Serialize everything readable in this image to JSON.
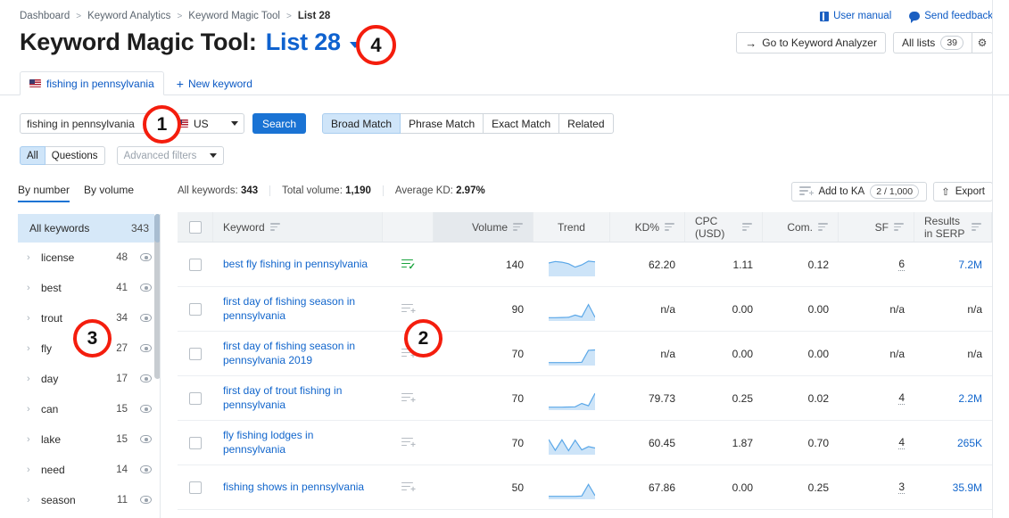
{
  "breadcrumb": [
    "Dashboard",
    "Keyword Analytics",
    "Keyword Magic Tool",
    "List 28"
  ],
  "top_links": [
    {
      "label": "User manual",
      "icon": "book-icon"
    },
    {
      "label": "Send feedback",
      "icon": "speech-bubble-icon"
    }
  ],
  "title": {
    "prefix": "Keyword Magic Tool:",
    "list_name": "List 28"
  },
  "header_buttons": {
    "go_to_analyzer": "Go to Keyword Analyzer",
    "all_lists": "All lists",
    "all_lists_count": "39",
    "gear": "⚙"
  },
  "tabs": {
    "active": "fishing in pennsylvania",
    "new_keyword": "New keyword"
  },
  "search": {
    "keyword_value": "fishing in pennsylvania",
    "database": "US",
    "search_button": "Search",
    "match_types": [
      "Broad Match",
      "Phrase Match",
      "Exact Match",
      "Related"
    ],
    "match_active": "Broad Match"
  },
  "filters": {
    "segments": [
      "All",
      "Questions"
    ],
    "segment_active": "All",
    "advanced_placeholder": "Advanced filters"
  },
  "sort_tabs": {
    "items": [
      "By number",
      "By volume"
    ],
    "active": "By number"
  },
  "stats": {
    "all_keywords_label": "All keywords:",
    "all_keywords_value": "343",
    "total_volume_label": "Total volume:",
    "total_volume_value": "1,190",
    "average_kd_label": "Average KD:",
    "average_kd_value": "2.97%"
  },
  "table_actions": {
    "add_to_ka": "Add to KA",
    "add_to_ka_count": "2 / 1,000",
    "export": "Export"
  },
  "sidebar": {
    "header": {
      "label": "All keywords",
      "count": "343"
    },
    "items": [
      {
        "label": "license",
        "count": "48"
      },
      {
        "label": "best",
        "count": "41"
      },
      {
        "label": "trout",
        "count": "34"
      },
      {
        "label": "fly",
        "count": "27"
      },
      {
        "label": "day",
        "count": "17"
      },
      {
        "label": "can",
        "count": "15"
      },
      {
        "label": "lake",
        "count": "15"
      },
      {
        "label": "need",
        "count": "14"
      },
      {
        "label": "season",
        "count": "11"
      }
    ]
  },
  "table": {
    "columns": [
      {
        "key": "keyword",
        "label": "Keyword",
        "sortable": true
      },
      {
        "key": "volume",
        "label": "Volume",
        "sortable": true
      },
      {
        "key": "trend",
        "label": "Trend",
        "sortable": false
      },
      {
        "key": "kd",
        "label": "KD%",
        "sortable": true
      },
      {
        "key": "cpc",
        "label": "CPC (USD)",
        "sortable": true
      },
      {
        "key": "com",
        "label": "Com.",
        "sortable": true
      },
      {
        "key": "sf",
        "label": "SF",
        "sortable": true
      },
      {
        "key": "serp",
        "label": "Results in SERP",
        "sortable": true
      }
    ],
    "rows": [
      {
        "keyword": "best fly fishing in pennsylvania",
        "added": true,
        "volume": "140",
        "trend": [
          62,
          70,
          66,
          58,
          40,
          52,
          72,
          68
        ],
        "kd": "62.20",
        "cpc": "1.11",
        "com": "0.12",
        "sf": "6",
        "serp": "7.2M"
      },
      {
        "keyword": "first day of fishing season in pennsylvania",
        "added": false,
        "volume": "90",
        "trend": [
          8,
          8,
          9,
          10,
          22,
          12,
          78,
          10
        ],
        "kd": "n/a",
        "cpc": "0.00",
        "com": "0.00",
        "sf": "n/a",
        "serp": "n/a"
      },
      {
        "keyword": "first day of fishing season in pennsylvania 2019",
        "added": false,
        "volume": "70",
        "trend": [
          6,
          6,
          6,
          6,
          6,
          8,
          72,
          74
        ],
        "kd": "n/a",
        "cpc": "0.00",
        "com": "0.00",
        "sf": "n/a",
        "serp": "n/a"
      },
      {
        "keyword": "first day of trout fishing in pennsylvania",
        "added": false,
        "volume": "70",
        "trend": [
          6,
          6,
          6,
          7,
          8,
          26,
          14,
          80
        ],
        "kd": "79.73",
        "cpc": "0.25",
        "com": "0.02",
        "sf": "4",
        "serp": "2.2M"
      },
      {
        "keyword": "fly fishing lodges in pennsylvania",
        "added": false,
        "volume": "70",
        "trend": [
          72,
          14,
          70,
          12,
          68,
          16,
          34,
          26
        ],
        "kd": "60.45",
        "cpc": "1.87",
        "com": "0.70",
        "sf": "4",
        "serp": "265K"
      },
      {
        "keyword": "fishing shows in pennsylvania",
        "added": false,
        "volume": "50",
        "trend": [
          6,
          6,
          6,
          6,
          6,
          8,
          70,
          10
        ],
        "kd": "67.86",
        "cpc": "0.00",
        "com": "0.25",
        "sf": "3",
        "serp": "35.9M"
      }
    ]
  },
  "annotations": [
    {
      "id": "1",
      "number": "1"
    },
    {
      "id": "2",
      "number": "2"
    },
    {
      "id": "3",
      "number": "3"
    },
    {
      "id": "4",
      "number": "4"
    }
  ],
  "colors": {
    "link": "#1266cc",
    "primary_button": "#1a73d4",
    "active_segment": "#cfe5f9",
    "sidebar_header": "#d6e8f8",
    "annotation": "#f41d0d",
    "spark": "#5aa7e8",
    "spark_fill": "#cde4f8",
    "added_icon": "#19a33d"
  }
}
